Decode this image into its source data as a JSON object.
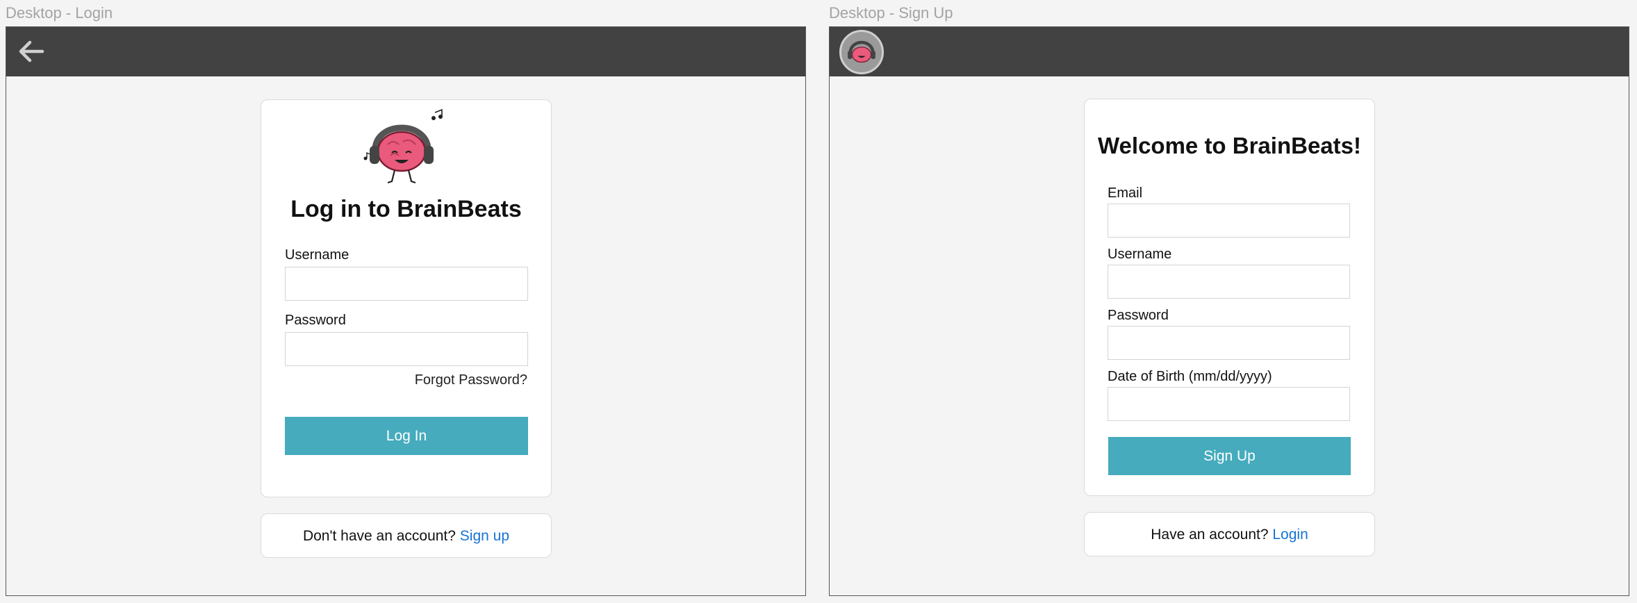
{
  "login_screen": {
    "frame_label": "Desktop - Login",
    "back_icon": "back-arrow-icon",
    "logo_icon": "brain-headphones-logo",
    "title": "Log in to BrainBeats",
    "username_label": "Username",
    "username_value": "",
    "password_label": "Password",
    "password_value": "",
    "forgot_password": "Forgot Password?",
    "login_button": "Log In",
    "footer_prompt": "Don't have an account?",
    "footer_link": "Sign up"
  },
  "signup_screen": {
    "frame_label": "Desktop - Sign Up",
    "avatar_icon": "brain-avatar-icon",
    "title": "Welcome to BrainBeats!",
    "email_label": "Email",
    "email_value": "",
    "username_label": "Username",
    "username_value": "",
    "password_label": "Password",
    "password_value": "",
    "dob_label": "Date of Birth (mm/dd/yyyy)",
    "dob_value": "",
    "signup_button": "Sign Up",
    "footer_prompt": "Have an account?",
    "footer_link": "Login"
  },
  "colors": {
    "topbar": "#424242",
    "accent_button": "#45abbd",
    "link": "#1673d6",
    "brain": "#ea5a7c"
  }
}
